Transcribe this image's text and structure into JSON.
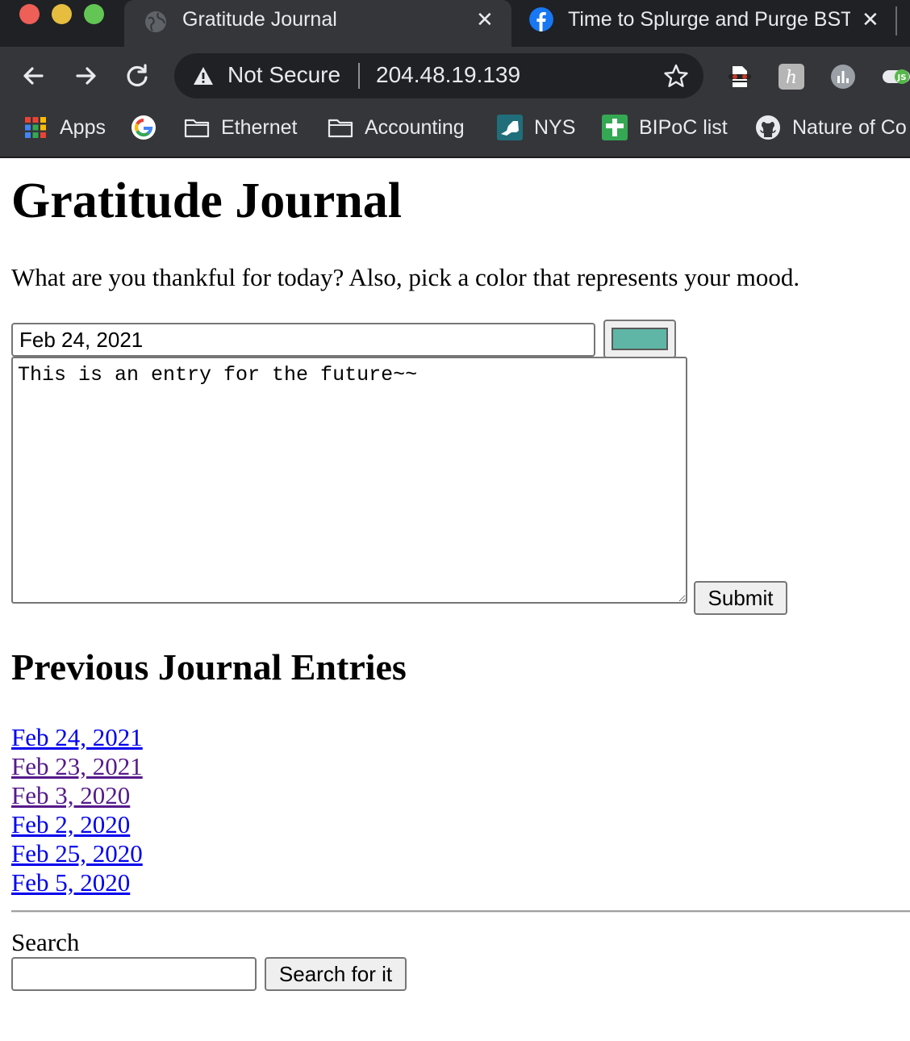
{
  "browser": {
    "tabs": [
      {
        "title": "Gratitude Journal",
        "active": true,
        "icon": "globe-icon"
      },
      {
        "title": "Time to Splurge and Purge BST",
        "active": false,
        "icon": "facebook-icon"
      }
    ],
    "close_glyph": "✕",
    "address_bar": {
      "security_status": "Not Secure",
      "url": "204.48.19.139"
    },
    "bookmarks": [
      {
        "label": "Apps",
        "icon": "apps-grid-icon"
      },
      {
        "label": "",
        "icon": "google-icon"
      },
      {
        "label": "Ethernet",
        "icon": "folder-icon"
      },
      {
        "label": "Accounting",
        "icon": "folder-icon"
      },
      {
        "label": "NYS",
        "icon": "nys-icon"
      },
      {
        "label": "BIPoC list",
        "icon": "sheets-plus-icon"
      },
      {
        "label": "Nature of Co",
        "icon": "github-icon"
      }
    ],
    "colors": {
      "tabstrip": "#202124",
      "toolbar": "#35363a",
      "text": "#e8eaed"
    }
  },
  "page": {
    "title": "Gratitude Journal",
    "prompt": "What are you thankful for today? Also, pick a color that represents your mood.",
    "form": {
      "date_value": "Feb 24, 2021",
      "mood_color": "#5fb6a6",
      "entry_text": "This is an entry for the future~~",
      "submit_label": "Submit"
    },
    "entries_heading": "Previous Journal Entries",
    "entries": [
      {
        "label": "Feb 24, 2021",
        "visited": false
      },
      {
        "label": "Feb 23, 2021",
        "visited": true
      },
      {
        "label": "Feb 3, 2020",
        "visited": true
      },
      {
        "label": "Feb 2, 2020",
        "visited": false
      },
      {
        "label": "Feb 25, 2020",
        "visited": false
      },
      {
        "label": "Feb 5, 2020",
        "visited": false
      }
    ],
    "search": {
      "label": "Search",
      "value": "",
      "button_label": "Search for it"
    }
  }
}
